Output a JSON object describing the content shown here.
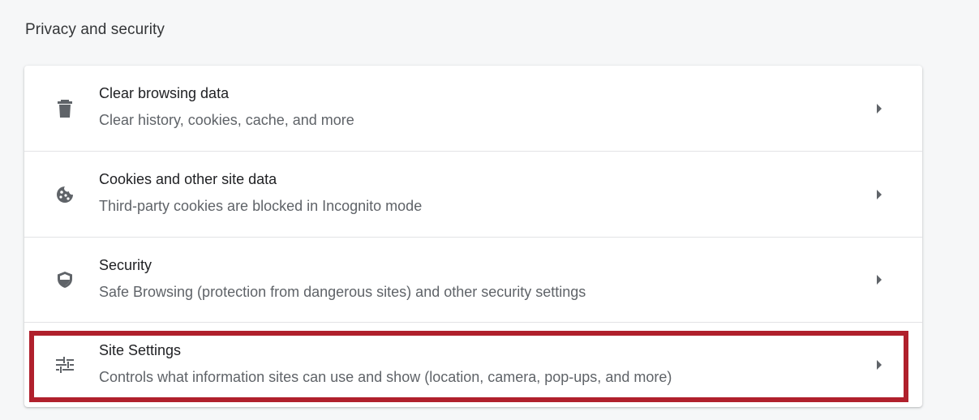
{
  "section": {
    "title": "Privacy and security"
  },
  "rows": [
    {
      "icon": "trash-icon",
      "title": "Clear browsing data",
      "description": "Clear history, cookies, cache, and more"
    },
    {
      "icon": "cookie-icon",
      "title": "Cookies and other site data",
      "description": "Third-party cookies are blocked in Incognito mode"
    },
    {
      "icon": "shield-icon",
      "title": "Security",
      "description": "Safe Browsing (protection from dangerous sites) and other security settings"
    },
    {
      "icon": "tune-sliders-icon",
      "title": "Site Settings",
      "description": "Controls what information sites can use and show (location, camera, pop-ups, and more)",
      "highlighted": true
    }
  ],
  "colors": {
    "highlight": "#b0202c",
    "background": "#f6f7f8",
    "card": "#ffffff",
    "icon": "#5f6368"
  }
}
